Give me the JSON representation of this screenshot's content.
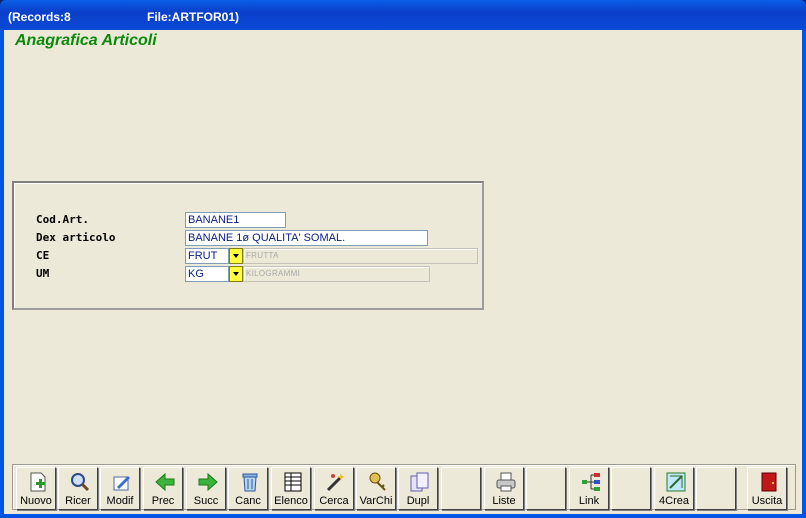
{
  "window": {
    "records_label": "(Records:8",
    "file_label": "File:ARTFOR01)"
  },
  "form": {
    "title": "Anagrafica Articoli",
    "fields": {
      "cod_art": {
        "label": "Cod.Art.",
        "value": "BANANE1"
      },
      "dex_articolo": {
        "label": "Dex articolo",
        "value": "BANANE 1ø QUALITA' SOMAL."
      },
      "ce": {
        "label": "CE",
        "value": "FRUT",
        "desc": "FRUTTA"
      },
      "um": {
        "label": "UM",
        "value": "KG",
        "desc": "KILOGRAMMI"
      }
    }
  },
  "toolbar": {
    "buttons": [
      {
        "label": "Nuovo",
        "icon": "new-document-icon"
      },
      {
        "label": "Ricer",
        "icon": "search-icon"
      },
      {
        "label": "Modif",
        "icon": "edit-icon"
      },
      {
        "label": "Prec",
        "icon": "arrow-left-icon"
      },
      {
        "label": "Succ",
        "icon": "arrow-right-icon"
      },
      {
        "label": "Canc",
        "icon": "trash-icon"
      },
      {
        "label": "Elenco",
        "icon": "table-icon"
      },
      {
        "label": "Cerca",
        "icon": "magic-wand-icon"
      },
      {
        "label": "VarChi",
        "icon": "keys-icon"
      },
      {
        "label": "Dupl",
        "icon": "duplicate-icon"
      },
      {
        "label": "",
        "icon": ""
      },
      {
        "label": "Liste",
        "icon": "printer-icon"
      },
      {
        "label": "",
        "icon": ""
      },
      {
        "label": "Link",
        "icon": "link-tree-icon"
      },
      {
        "label": "",
        "icon": ""
      },
      {
        "label": "4Crea",
        "icon": "create-icon"
      },
      {
        "label": "",
        "icon": ""
      },
      {
        "label": "Uscita",
        "icon": "exit-door-icon"
      }
    ]
  },
  "colors": {
    "title_green": "#0a8a0a",
    "field_text": "#0a1e82",
    "dropdown_yellow": "#ffff40"
  }
}
